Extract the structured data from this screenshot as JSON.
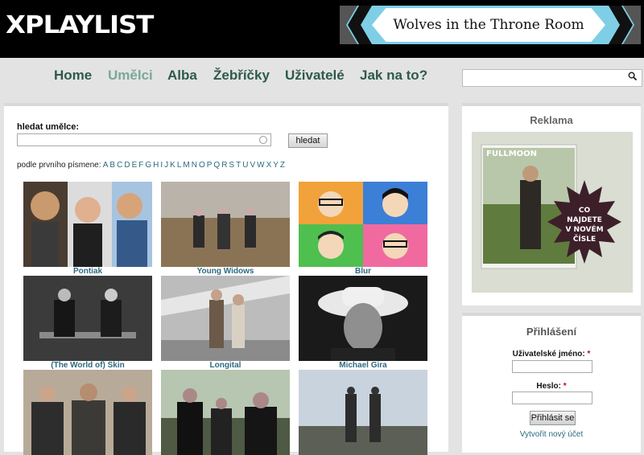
{
  "header": {
    "logo": "XPLAYLIST",
    "banner_text": "Wolves in the Throne Room"
  },
  "nav": {
    "items": [
      "Home",
      "Umělci",
      "Alba",
      "Žebříčky",
      "Uživatelé",
      "Jak na to?"
    ],
    "active": "Umělci"
  },
  "search": {
    "placeholder": ""
  },
  "artist_search": {
    "label": "hledat umělce:",
    "button": "hledat",
    "by_letter_label": "podle prvního písmene:",
    "letters": [
      "A",
      "B",
      "C",
      "D",
      "E",
      "F",
      "G",
      "H",
      "I",
      "J",
      "K",
      "L",
      "M",
      "N",
      "O",
      "P",
      "Q",
      "R",
      "S",
      "T",
      "U",
      "V",
      "W",
      "X",
      "Y",
      "Z"
    ]
  },
  "artists": [
    {
      "name": "Pontiak",
      "icon": "band-photo"
    },
    {
      "name": "Young Widows",
      "icon": "band-photo"
    },
    {
      "name": "Blur",
      "icon": "cartoon-portraits"
    },
    {
      "name": "(The World of) Skin",
      "icon": "band-photo"
    },
    {
      "name": "Longital",
      "icon": "band-photo"
    },
    {
      "name": "Michael Gira",
      "icon": "portrait-photo"
    },
    {
      "name": "",
      "icon": "band-photo"
    },
    {
      "name": "",
      "icon": "band-photo"
    },
    {
      "name": "",
      "icon": "band-photo"
    }
  ],
  "ad": {
    "heading": "Reklama",
    "magazine_title": "FULLMOON",
    "badge_text": "CO NAJDETE V NOVÉM ČÍSLE"
  },
  "login": {
    "heading": "Přihlášení",
    "username_label": "Uživatelské jméno:",
    "password_label": "Heslo:",
    "required_mark": "*",
    "button": "Přihlásit se",
    "register_link": "Vytvořit nový účet"
  },
  "colors": {
    "nav_text": "#2e5a4b",
    "nav_active": "#7aa89a",
    "link": "#2e6a80",
    "banner_bg": "#7ecfe6"
  }
}
